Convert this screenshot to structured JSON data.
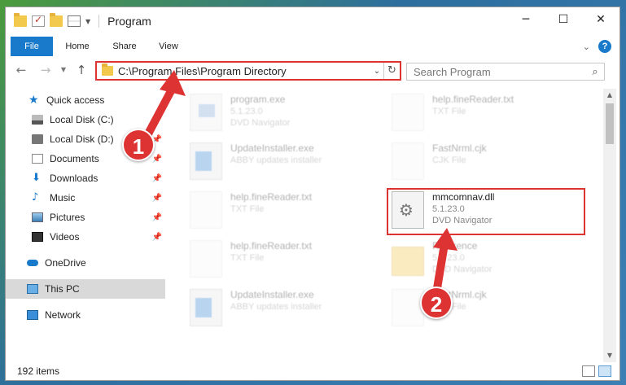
{
  "window": {
    "title": "Program",
    "controls": {
      "minimize": "─",
      "maximize": "☐",
      "close": "✕"
    }
  },
  "ribbon": {
    "tabs": [
      "File",
      "Home",
      "Share",
      "View"
    ],
    "help": "?"
  },
  "nav": {
    "address": "C:\\Program Files\\Program Directory",
    "search_placeholder": "Search Program"
  },
  "sidebar": {
    "items": [
      {
        "label": "Quick access",
        "icon": "star-icon"
      },
      {
        "label": "Local Disk (C:)",
        "icon": "drive-icon",
        "pinned": true
      },
      {
        "label": "Local Disk (D:)",
        "icon": "drive-icon",
        "pinned": true
      },
      {
        "label": "Documents",
        "icon": "documents-icon",
        "pinned": true
      },
      {
        "label": "Downloads",
        "icon": "download-icon",
        "pinned": true
      },
      {
        "label": "Music",
        "icon": "music-icon",
        "pinned": true
      },
      {
        "label": "Pictures",
        "icon": "pictures-icon",
        "pinned": true
      },
      {
        "label": "Videos",
        "icon": "videos-icon",
        "pinned": true
      },
      {
        "label": "OneDrive",
        "icon": "onedrive-icon"
      },
      {
        "label": "This PC",
        "icon": "computer-icon",
        "selected": true
      },
      {
        "label": "Network",
        "icon": "network-icon"
      }
    ]
  },
  "files": [
    {
      "name": "program.exe",
      "line2": "5.1.23.0",
      "line3": "DVD Navigator",
      "icon": "program-icon",
      "faded": true
    },
    {
      "name": "help.fineReader.txt",
      "line2": "TXT File",
      "line3": "",
      "icon": "text-file-icon",
      "faded": true
    },
    {
      "name": "UpdateInstaller.exe",
      "line2": "ABBY updates installer",
      "line3": "",
      "icon": "installer-icon",
      "faded": true
    },
    {
      "name": "FastNrml.cjk",
      "line2": "CJK File",
      "line3": "",
      "icon": "text-file-icon",
      "faded": true
    },
    {
      "name": "help.fineReader.txt",
      "line2": "TXT File",
      "line3": "",
      "icon": "text-file-icon",
      "faded": true
    },
    {
      "name": "mmcomnav.dll",
      "line2": "5.1.23.0",
      "line3": "DVD Navigator",
      "icon": "dll-gear-icon",
      "faded": false,
      "highlighted": true
    },
    {
      "name": "help.fineReader.txt",
      "line2": "TXT File",
      "line3": "",
      "icon": "text-file-icon",
      "faded": true
    },
    {
      "name": "Reference",
      "line2": "5.1.23.0",
      "line3": "DVD Navigator",
      "icon": "folder-icon",
      "faded": true
    },
    {
      "name": "UpdateInstaller.exe",
      "line2": "ABBY updates installer",
      "line3": "",
      "icon": "installer-icon",
      "faded": true
    },
    {
      "name": "FastNrml.cjk",
      "line2": "CJK File",
      "line3": "",
      "icon": "text-file-icon",
      "faded": true
    }
  ],
  "status": {
    "items": "192 items"
  },
  "annotations": {
    "step1": "1",
    "step2": "2",
    "color": "#dd3333"
  }
}
